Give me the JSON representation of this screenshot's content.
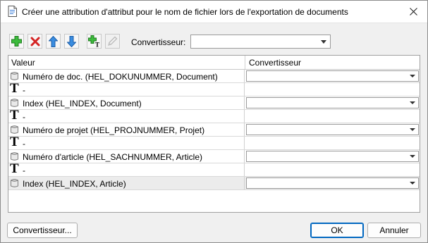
{
  "window": {
    "title": "Créer une attribution d'attribut pour le nom de fichier lors de l'exportation de documents"
  },
  "toolbar": {
    "buttons": [
      {
        "name": "add-button",
        "icon": "plus-icon",
        "color": "#2eaa2e",
        "enabled": true
      },
      {
        "name": "delete-button",
        "icon": "x-icon",
        "color": "#d22020",
        "enabled": true
      },
      {
        "name": "move-up-button",
        "icon": "arrow-up-icon",
        "color": "#2a7fd6",
        "enabled": true
      },
      {
        "name": "move-down-button",
        "icon": "arrow-down-icon",
        "color": "#2a7fd6",
        "enabled": true
      },
      {
        "name": "add-text-button",
        "icon": "plus-text-icon",
        "color": "#2eaa2e",
        "enabled": true
      },
      {
        "name": "edit-button",
        "icon": "pencil-icon",
        "color": "#b8b8b8",
        "enabled": false
      }
    ],
    "converter_label": "Convertisseur:",
    "converter_value": ""
  },
  "grid": {
    "columns": [
      "Valeur",
      "Convertisseur"
    ],
    "rows": [
      {
        "type": "attribute",
        "value": "Numéro de doc. (HEL_DOKUNUMMER, Document)",
        "converter": "",
        "has_combo": true,
        "selected": false
      },
      {
        "type": "text",
        "value": "-",
        "converter": "",
        "has_combo": false,
        "selected": false
      },
      {
        "type": "attribute",
        "value": "Index (HEL_INDEX, Document)",
        "converter": "",
        "has_combo": true,
        "selected": false
      },
      {
        "type": "text",
        "value": "-",
        "converter": "",
        "has_combo": false,
        "selected": false
      },
      {
        "type": "attribute",
        "value": "Numéro de projet (HEL_PROJNUMMER, Projet)",
        "converter": "",
        "has_combo": true,
        "selected": false
      },
      {
        "type": "text",
        "value": "-",
        "converter": "",
        "has_combo": false,
        "selected": false
      },
      {
        "type": "attribute",
        "value": "Numéro d'article (HEL_SACHNUMMER, Article)",
        "converter": "",
        "has_combo": true,
        "selected": false
      },
      {
        "type": "text",
        "value": "-",
        "converter": "",
        "has_combo": false,
        "selected": false
      },
      {
        "type": "attribute",
        "value": "Index (HEL_INDEX, Article)",
        "converter": "",
        "has_combo": true,
        "selected": true
      }
    ]
  },
  "footer": {
    "converters_button": "Convertisseur...",
    "ok_button": "OK",
    "cancel_button": "Annuler"
  }
}
